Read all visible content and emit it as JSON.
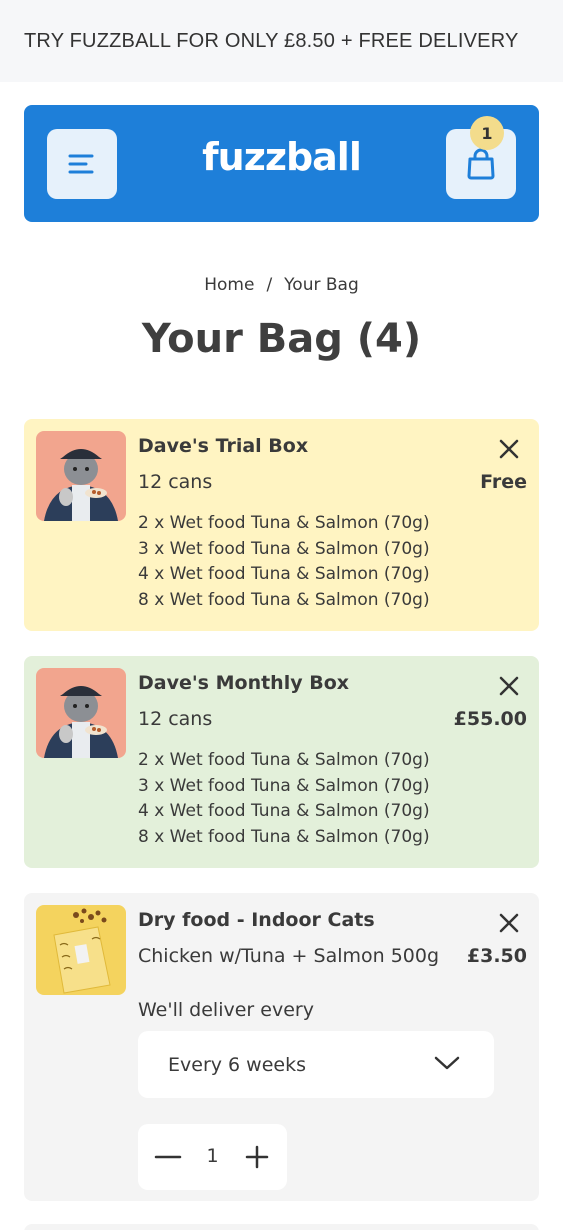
{
  "promo": {
    "text": "TRY FUZZBALL FOR ONLY £8.50 + FREE DELIVERY"
  },
  "header": {
    "logo": "fuzzball",
    "bag_count": "1",
    "menu_icon": "menu-icon",
    "bag_icon": "shopping-bag-icon"
  },
  "breadcrumb": {
    "home": "Home",
    "separator": "/",
    "current": "Your Bag"
  },
  "page": {
    "title": "Your Bag (4)"
  },
  "colors": {
    "header": "#1e7fd9",
    "trial_bg": "#fff4c2",
    "monthly_bg": "#e3f0da",
    "dry_bg": "#f4f4f4",
    "badge": "#f3dc8c"
  },
  "cart": [
    {
      "name": "Dave's Trial Box",
      "subtitle": "12 cans",
      "price": "Free",
      "contents": [
        "2 x Wet food Tuna & Salmon (70g)",
        "3 x Wet food Tuna & Salmon (70g)",
        "4 x Wet food Tuna & Salmon (70g)",
        "8 x Wet food Tuna & Salmon (70g)"
      ]
    },
    {
      "name": "Dave's Monthly Box",
      "subtitle": "12 cans",
      "price": "£55.00",
      "contents": [
        "2 x Wet food Tuna & Salmon (70g)",
        "3 x Wet food Tuna & Salmon (70g)",
        "4 x Wet food Tuna & Salmon (70g)",
        "8 x Wet food Tuna & Salmon (70g)"
      ]
    },
    {
      "name": "Dry food - Indoor Cats",
      "subtitle": "Chicken w/Tuna + Salmon 500g",
      "price": "£3.50",
      "deliver_label": "We'll deliver every",
      "frequency": "Every 6 weeks",
      "quantity": "1"
    }
  ]
}
